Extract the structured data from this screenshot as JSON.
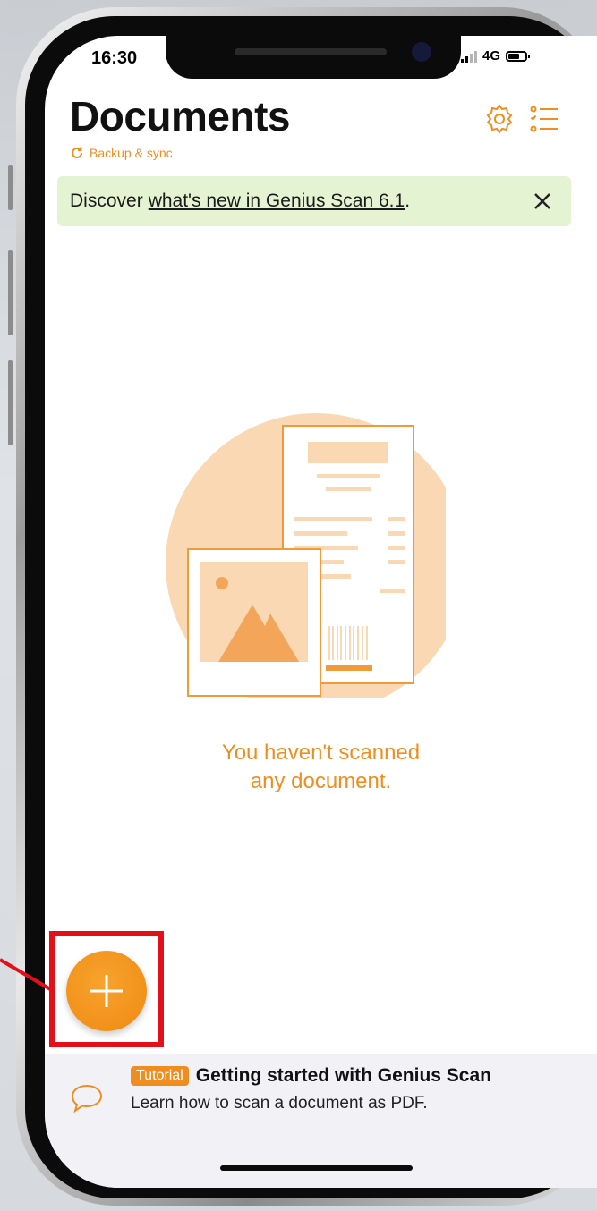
{
  "status_bar": {
    "time": "16:30",
    "network": "4G"
  },
  "header": {
    "title": "Documents",
    "sync_label": "Backup & sync"
  },
  "banner": {
    "prefix": "Discover",
    "link_text": "what's new in Genius Scan 6.1",
    "suffix": "."
  },
  "empty_state": {
    "line1": "You haven't scanned",
    "line2": "any document."
  },
  "tutorial": {
    "badge": "Tutorial",
    "title": "Getting started with Genius Scan",
    "subtitle": "Learn how to scan a document as PDF."
  },
  "icons": {
    "sync": "sync-icon",
    "settings": "gear-icon",
    "list": "list-icon",
    "close": "close-icon",
    "add": "plus-icon",
    "chat": "speech-bubble-icon"
  },
  "colors": {
    "accent": "#ef8d1e",
    "banner_bg": "#e4f4d2",
    "highlight": "#e3101a"
  }
}
